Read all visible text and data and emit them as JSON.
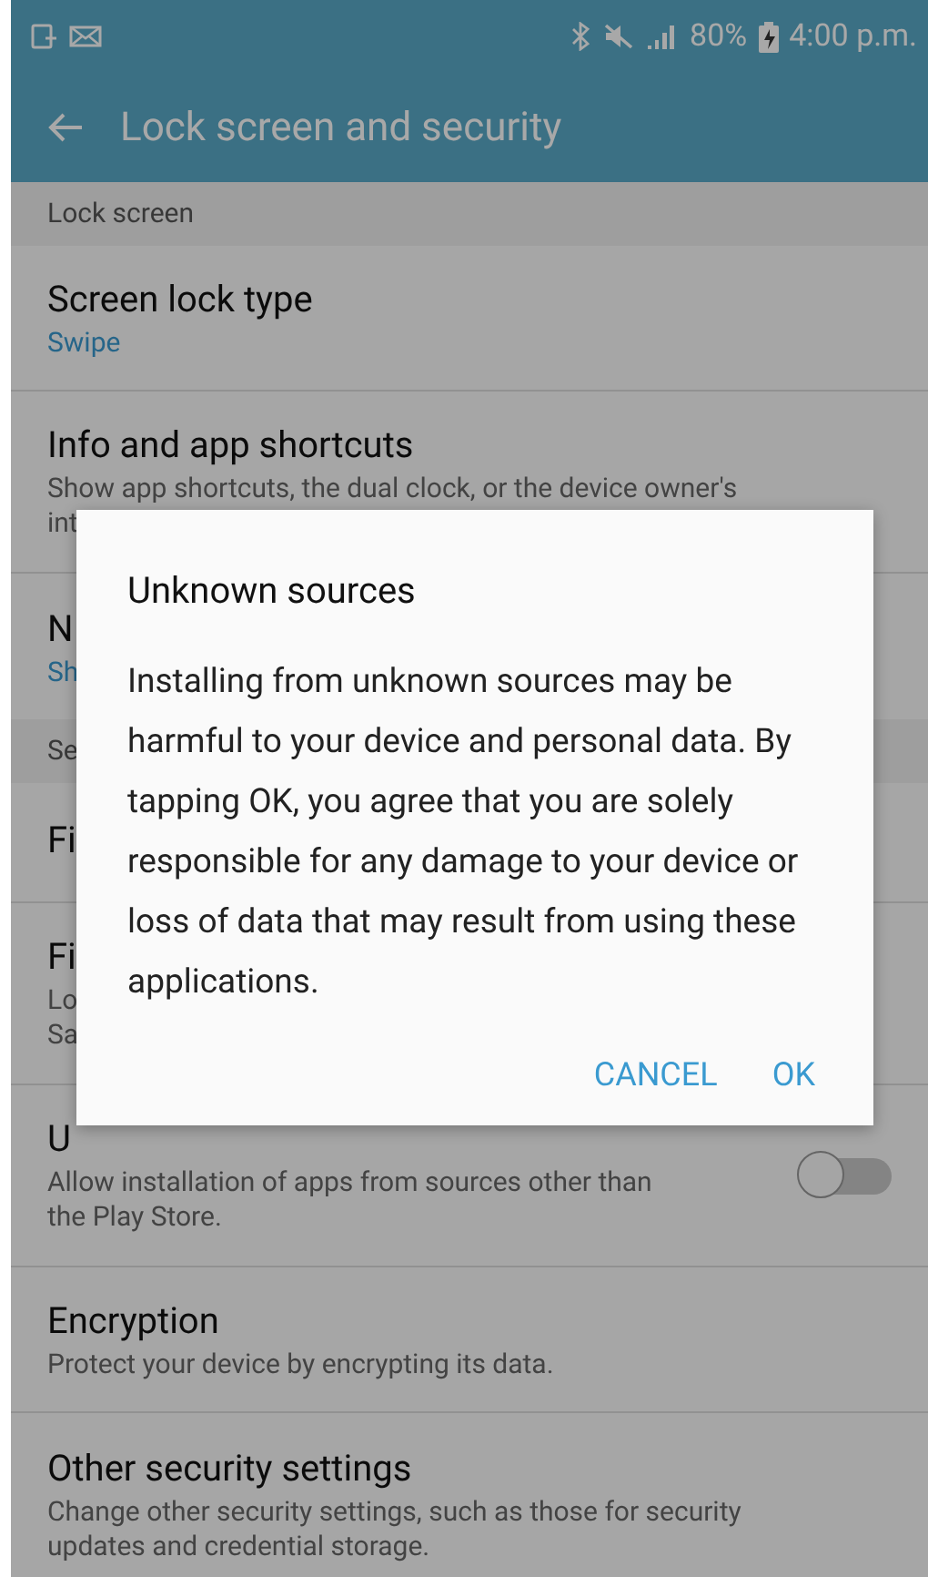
{
  "status_bar": {
    "battery": "80%",
    "time": "4:00 p.m."
  },
  "app_bar": {
    "title": "Lock screen and security"
  },
  "sections": [
    {
      "header": "Lock screen",
      "items": [
        {
          "kind": "plain",
          "title": "Screen lock type",
          "value": "Swipe"
        },
        {
          "kind": "plain",
          "title": "Info and app shortcuts",
          "summary": [
            "Show app shortcuts, the dual clock, or the device owner's",
            "int"
          ]
        },
        {
          "kind": "plain",
          "title": "N",
          "value": "Sh"
        }
      ]
    },
    {
      "header": "Se",
      "items": [
        {
          "kind": "plain",
          "title": "Fi"
        },
        {
          "kind": "plain",
          "title": "Fi",
          "summary": [
            "Lo",
            "Sa"
          ]
        },
        {
          "kind": "switch",
          "title": "U",
          "summary": [
            "Allow installation of apps from sources other than",
            "the Play Store."
          ],
          "on": false
        },
        {
          "kind": "plain",
          "title": "Encryption",
          "summary": [
            "Protect your device by encrypting its data."
          ]
        },
        {
          "kind": "plain",
          "title": "Other security settings",
          "summary": [
            "Change other security settings, such as those for security",
            "updates and credential storage."
          ]
        }
      ]
    }
  ],
  "dialog": {
    "title": "Unknown sources",
    "message": "Installing from unknown sources may be harmful to your device and personal data. By tapping OK, you agree that you are solely responsible for any damage to your device or loss of data that may result from using these applications.",
    "buttons": [
      "CANCEL",
      "OK"
    ]
  }
}
